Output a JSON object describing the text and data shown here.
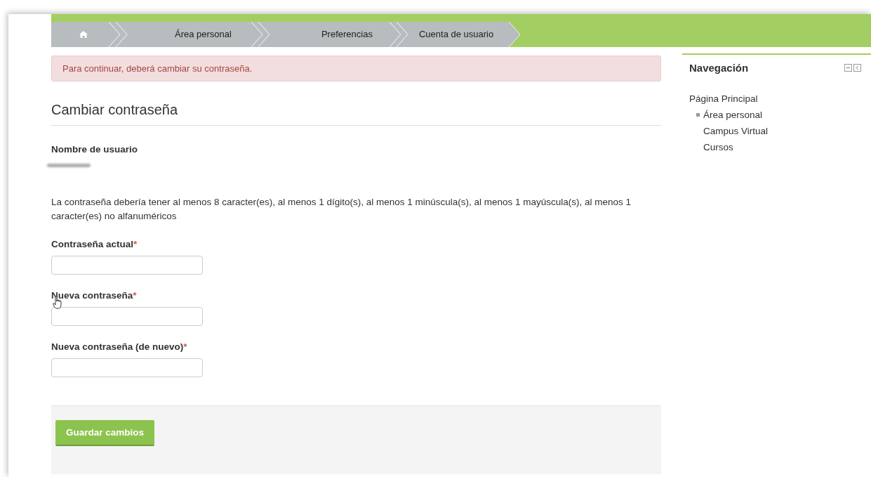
{
  "breadcrumb": [
    {
      "kind": "home"
    },
    {
      "kind": "link",
      "label": "Área personal"
    },
    {
      "kind": "link",
      "label": "Preferencias"
    },
    {
      "kind": "link",
      "label": "Cuenta de usuario"
    }
  ],
  "alert": {
    "text": "Para continuar, deberá cambiar su contraseña."
  },
  "form": {
    "title": "Cambiar contraseña",
    "username": {
      "label": "Nombre de usuario",
      "redacted": true
    },
    "policy": "La contraseña debería tener al menos 8 caracter(es), al menos 1 dígito(s), al menos 1 minúscula(s), al menos 1 mayúscula(s), al menos 1 caracter(es) no alfanuméricos",
    "fields": [
      {
        "label": "Contraseña actual",
        "required_mark": "*",
        "pointer": false
      },
      {
        "label": "Nueva contraseña",
        "required_mark": "*",
        "pointer": true
      },
      {
        "label": "Nueva contraseña (de nuevo)",
        "required_mark": "*",
        "pointer": false
      }
    ],
    "submit": "Guardar cambios"
  },
  "navigation": {
    "title": "Navegación",
    "items": [
      {
        "label": "Página Principal",
        "bullet": false,
        "children": [
          {
            "label": "Área personal",
            "bullet": true
          },
          {
            "label": "Campus Virtual",
            "bullet": false
          },
          {
            "label": "Cursos",
            "bullet": false
          }
        ]
      }
    ]
  }
}
